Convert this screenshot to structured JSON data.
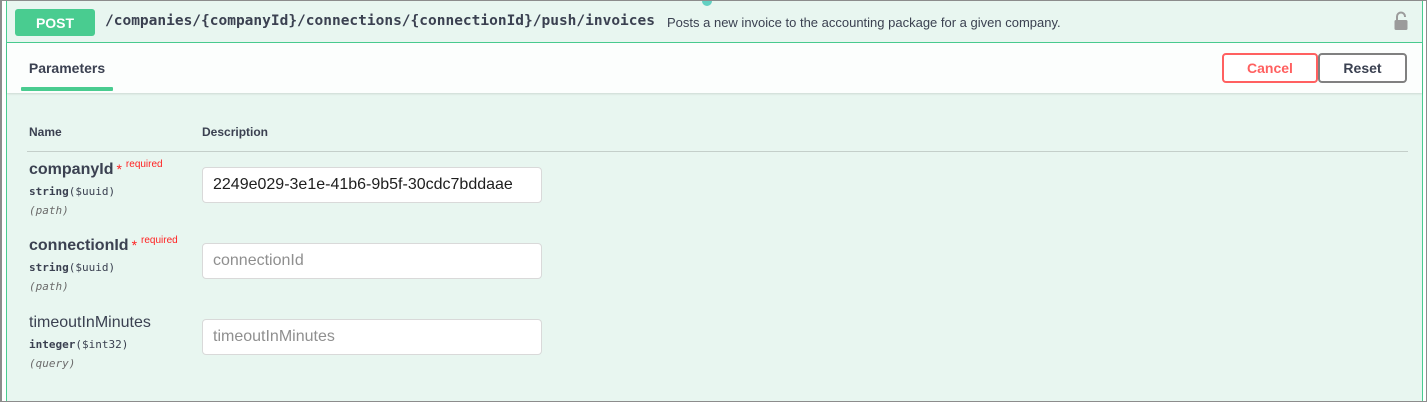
{
  "operation": {
    "method": "POST",
    "path": "/companies/{companyId}/connections/{connectionId}/push/invoices",
    "summary": "Posts a new invoice to the accounting package for a given company.",
    "lock_icon": "lock-icon"
  },
  "section": {
    "tab_label": "Parameters",
    "cancel_label": "Cancel",
    "reset_label": "Reset"
  },
  "table": {
    "name_header": "Name",
    "description_header": "Description"
  },
  "params": [
    {
      "name": "companyId",
      "star": "*",
      "required_label": "required",
      "type": "string",
      "format": "($uuid)",
      "in": "(path)",
      "value": "2249e029-3e1e-41b6-9b5f-30cdc7bddaae",
      "placeholder": "companyId"
    },
    {
      "name": "connectionId",
      "star": "*",
      "required_label": "required",
      "type": "string",
      "format": "($uuid)",
      "in": "(path)",
      "value": "",
      "placeholder": "connectionId"
    },
    {
      "name": "timeoutInMinutes",
      "type": "integer",
      "format": "($int32)",
      "in": "(query)",
      "value": "",
      "placeholder": "timeoutInMinutes"
    }
  ],
  "colors": {
    "post_green": "#49cc90",
    "block_bg": "#e8f6f0",
    "cancel_red": "#ff6060",
    "required_red": "#ff2222"
  }
}
